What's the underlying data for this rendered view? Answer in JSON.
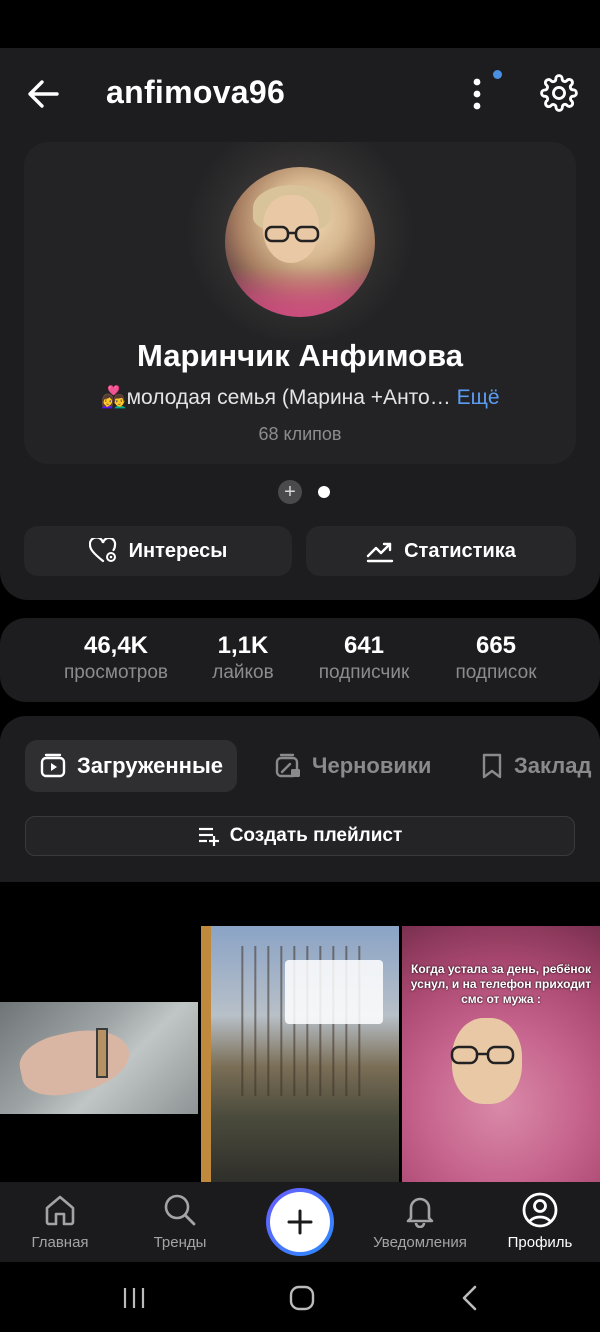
{
  "header": {
    "username": "anfimova96",
    "icons": {
      "back": "arrow-left-icon",
      "more": "more-vertical-icon",
      "settings": "gear-icon"
    },
    "notification_dot_color": "#4a90e2"
  },
  "profile": {
    "display_name": "Маринчик Анфимова",
    "bio_emoji": "👩‍❤️‍👨",
    "bio_text": "молодая семья (Марина +Анто…",
    "bio_more": "Ещё",
    "clips_count": "68 клипов"
  },
  "pager": {
    "add_symbol": "+"
  },
  "actions": {
    "interests_label": "Интересы",
    "statistics_label": "Статистика"
  },
  "stats": [
    {
      "value": "46,4K",
      "label": "просмотров"
    },
    {
      "value": "1,1K",
      "label": "лайков"
    },
    {
      "value": "641",
      "label": "подписчик"
    },
    {
      "value": "665",
      "label": "подписок"
    }
  ],
  "tabs": {
    "uploaded": "Загруженные",
    "drafts": "Черновики",
    "bookmarks": "Заклад"
  },
  "playlist_button": "Создать плейлист",
  "thumbnails": {
    "third_caption": "Когда устала за день,  ребёнок уснул, и на телефон  приходит смс от мужа :"
  },
  "bottom_nav": [
    {
      "label": "Главная",
      "icon": "home-icon"
    },
    {
      "label": "Тренды",
      "icon": "search-icon"
    },
    {
      "label": "",
      "icon": "plus-icon"
    },
    {
      "label": "Уведомления",
      "icon": "bell-icon"
    },
    {
      "label": "Профиль",
      "icon": "profile-icon"
    }
  ],
  "colors": {
    "accent_link": "#5b9cf2",
    "background": "#000000",
    "panel": "#1d1d1f"
  }
}
